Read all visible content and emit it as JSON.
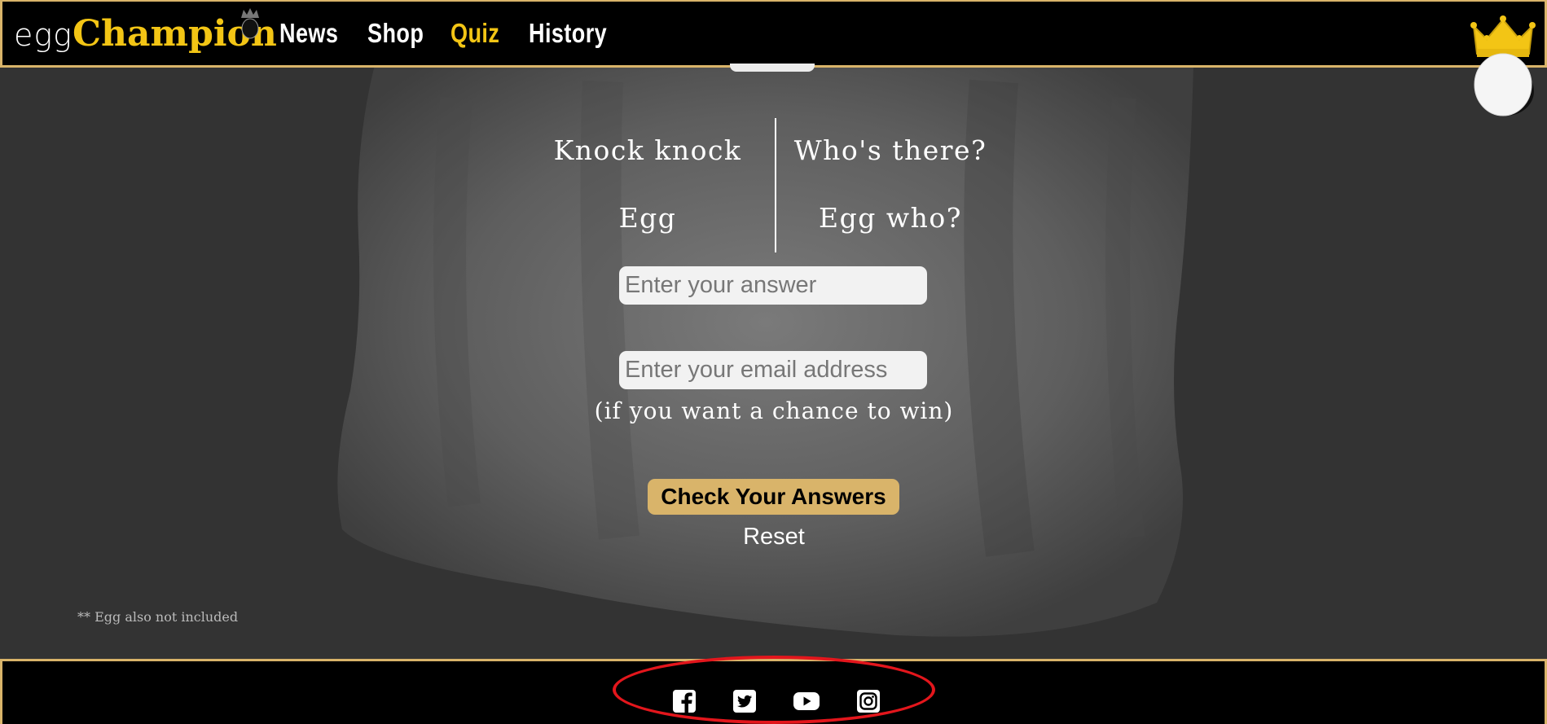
{
  "brand": {
    "prefix": "egg",
    "name": "Champion"
  },
  "nav": {
    "items": [
      {
        "label": "News",
        "active": false
      },
      {
        "label": "Shop",
        "active": false
      },
      {
        "label": "Quiz",
        "active": true
      },
      {
        "label": "History",
        "active": false
      }
    ]
  },
  "quiz": {
    "joke": {
      "left_1": "Knock knock",
      "right_1": "Who's there?",
      "left_2": "Egg",
      "right_2": "Egg who?"
    },
    "answer_placeholder": "Enter your answer",
    "email_placeholder": "Enter your email address",
    "email_note": "(if you want a chance to win)",
    "check_label": "Check Your Answers",
    "reset_label": "Reset",
    "footnote": "** Egg also not included"
  },
  "footer": {
    "social": [
      "facebook-icon",
      "twitter-icon",
      "youtube-icon",
      "instagram-icon"
    ]
  },
  "colors": {
    "accent": "#f3c515",
    "border": "#d9b46a",
    "background": "#333333",
    "highlight": "#e3161c"
  }
}
